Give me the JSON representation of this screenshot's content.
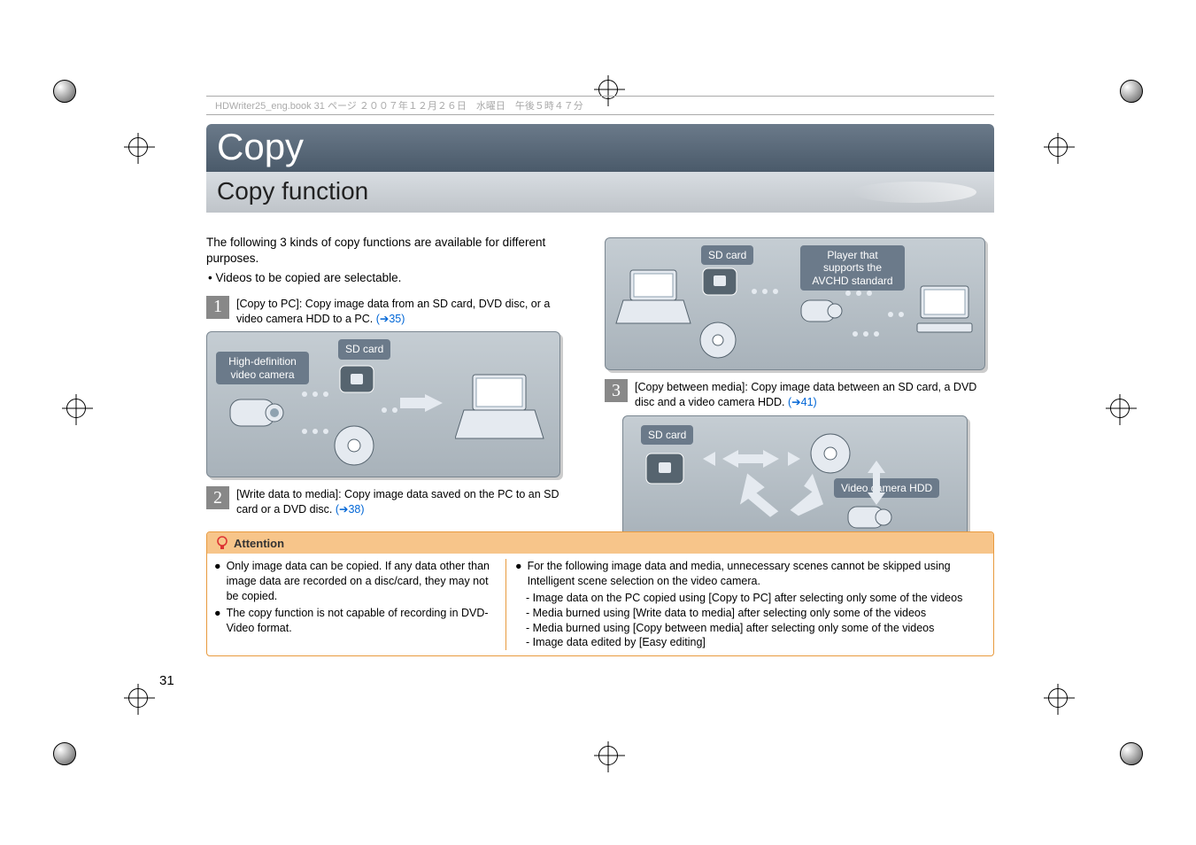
{
  "header_strip": "HDWriter25_eng.book  31 ページ  ２００７年１２月２６日　水曜日　午後５時４７分",
  "title": "Copy",
  "subtitle": "Copy function",
  "intro": "The following 3 kinds of copy functions are available for different purposes.",
  "intro_bullet": "• Videos to be copied are selectable.",
  "items": [
    {
      "num": "1",
      "text": "[Copy to PC]: Copy image data from an SD card, DVD disc, or a video camera HDD to a PC. ",
      "link": "(➔35)"
    },
    {
      "num": "2",
      "text": "[Write data to media]: Copy image data saved on the PC to an SD card or a DVD disc. ",
      "link": "(➔38)"
    },
    {
      "num": "3",
      "text": "[Copy between media]: Copy image data between an SD card, a DVD disc and a video camera HDD. ",
      "link": "(➔41)"
    }
  ],
  "dia1": {
    "label1": "High-definition video camera",
    "label2": "SD card"
  },
  "dia2": {
    "label1": "SD card",
    "label2": "Player that supports the AVCHD standard"
  },
  "dia3": {
    "label1": "SD card",
    "label2": "Video camera HDD"
  },
  "attention": {
    "header": "Attention",
    "col1": [
      "Only image data can be copied. If any data other than image data are recorded on a disc/card, they may not be copied.",
      "The copy function is not capable of recording in DVD-Video format."
    ],
    "col2_lead": "For the following image data and media, unnecessary scenes cannot be skipped using Intelligent scene selection on the video camera.",
    "col2_dashes": [
      "Image data on the PC copied using [Copy to PC] after selecting only some of the videos",
      "Media burned using [Write data to media] after selecting only some of the videos",
      "Media burned using [Copy between media] after selecting only some of the videos",
      "Image data edited by [Easy editing]"
    ]
  },
  "page_number": "31"
}
